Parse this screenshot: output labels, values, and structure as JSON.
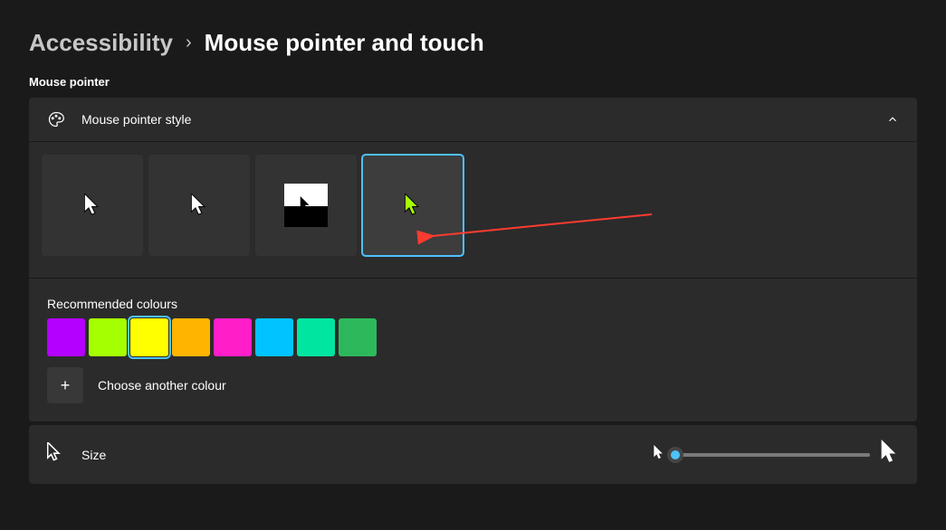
{
  "breadcrumbs": {
    "parent": "Accessibility",
    "separator": "›",
    "current": "Mouse pointer and touch"
  },
  "section_label": "Mouse pointer",
  "style_card": {
    "title": "Mouse pointer style",
    "styles": [
      {
        "id": "white",
        "selected": false
      },
      {
        "id": "black",
        "selected": false
      },
      {
        "id": "inverted",
        "selected": false
      },
      {
        "id": "custom",
        "selected": true,
        "cursor_color": "#a6ff00"
      }
    ]
  },
  "recommended": {
    "label": "Recommended colours",
    "colors": [
      {
        "hex": "#b400ff",
        "selected": false
      },
      {
        "hex": "#a6ff00",
        "selected": false
      },
      {
        "hex": "#ffff00",
        "selected": true
      },
      {
        "hex": "#ffb400",
        "selected": false
      },
      {
        "hex": "#ff1ec8",
        "selected": false
      },
      {
        "hex": "#00c3ff",
        "selected": false
      },
      {
        "hex": "#00e6a0",
        "selected": false
      },
      {
        "hex": "#2eb85c",
        "selected": false
      }
    ],
    "choose_label": "Choose another colour"
  },
  "size": {
    "label": "Size",
    "value": 1,
    "min": 1,
    "max": 15
  }
}
